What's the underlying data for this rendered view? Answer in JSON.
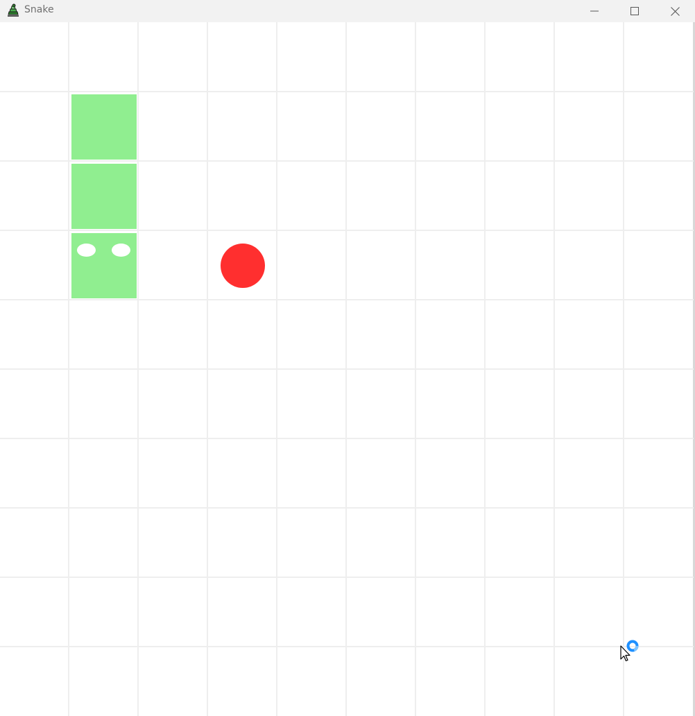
{
  "window": {
    "title": "Snake",
    "icon": "snake-app-icon",
    "controls": [
      "minimize-icon",
      "maximize-icon",
      "close-icon"
    ]
  },
  "game": {
    "grid": {
      "columns": 10,
      "rows": 10
    },
    "snake": {
      "color": "#90ee90",
      "eye_color": "#ffffff",
      "segments": [
        {
          "col": 1,
          "row": 3,
          "part": "head"
        },
        {
          "col": 1,
          "row": 2,
          "part": "body"
        },
        {
          "col": 1,
          "row": 1,
          "part": "body"
        }
      ]
    },
    "food": {
      "col": 3,
      "row": 3,
      "color": "#ff2f2f"
    }
  },
  "cursor": {
    "icon": "busy-arrow-cursor-icon"
  }
}
